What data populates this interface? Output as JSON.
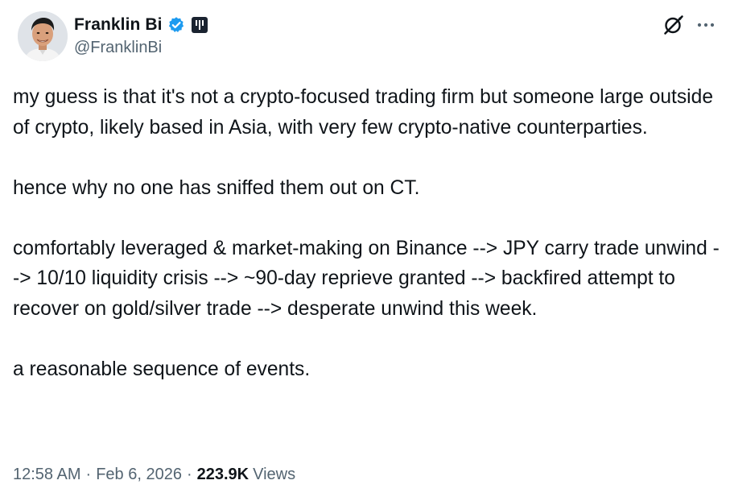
{
  "author": {
    "display_name": "Franklin Bi",
    "handle": "@FranklinBi",
    "verified_badge": "verified-badge-icon",
    "affiliate_badge": "affiliate-badge-icon"
  },
  "header_actions": {
    "grok_icon": "grok-icon",
    "more_icon": "more-icon"
  },
  "tweet": {
    "paragraphs": [
      "my guess is that it's not a crypto-focused trading firm but someone large outside of crypto, likely based in Asia, with very few crypto-native counterparties.",
      "hence why no one has sniffed them out on CT.",
      "comfortably leveraged & market-making on Binance --> JPY carry trade unwind --> 10/10 liquidity crisis --> ~90-day reprieve granted --> backfired attempt to recover on gold/silver trade --> desperate unwind this week.",
      "a reasonable sequence of events."
    ],
    "time": "12:58 AM",
    "date": "Feb 6, 2026",
    "separator": "·",
    "views_count": "223.9K",
    "views_label": "Views"
  },
  "colors": {
    "text_primary": "#0f1419",
    "text_secondary": "#536471",
    "verified_blue": "#1d9bf0",
    "affiliate_dark": "#1a2330"
  }
}
